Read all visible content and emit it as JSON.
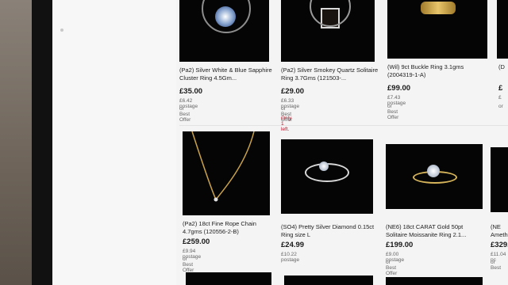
{
  "listings": [
    {
      "title": "(Pa2) Silver White & Blue Sapphire Cluster Ring 4.5Gm...",
      "price": "£35.00",
      "postage": "£6.42 postage",
      "offer": "or Best Offer"
    },
    {
      "title": "(Pa2) Silver Smokey Quartz Solitaire Ring 3.7Gms (121503-...",
      "price": "£29.00",
      "postage": "£6.33 postage",
      "offer": "or Best Offer",
      "note": "Only 1 left."
    },
    {
      "title": "(Wil) 9ct Buckle Ring 3.1gms (2004319-1-A)",
      "price": "£99.00",
      "postage": "£7.43 postage",
      "offer": "or Best Offer"
    },
    {
      "title": "(D",
      "price": "£",
      "postage": "£",
      "offer": "or"
    },
    {
      "title": "(Pa2) 18ct Fine Rope Chain 4.7gms (120556-2-B)",
      "price": "£259.00",
      "postage": "£9.94 postage",
      "offer": "or Best Offer"
    },
    {
      "title": "(SO4) Pretty Silver Diamond 0.15ct Ring size L",
      "price": "£24.99",
      "postage": "£10.22 postage"
    },
    {
      "title": "(NE6) 18ct CARAT Gold 50pt Solitaire Moissanite Ring 2.1...",
      "price": "£199.00",
      "postage": "£9.00 postage",
      "offer": "or Best Offer"
    },
    {
      "title": "(NE Ameth",
      "price": "£329.0",
      "postage": "£11.04 pc",
      "offer": "or Best"
    }
  ]
}
